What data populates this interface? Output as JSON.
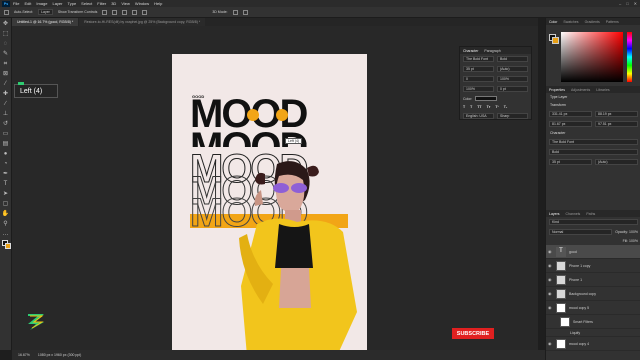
{
  "menubar": {
    "logo": "Ps",
    "items": [
      "File",
      "Edit",
      "Image",
      "Layer",
      "Type",
      "Select",
      "Filter",
      "3D",
      "View",
      "Window",
      "Help"
    ]
  },
  "options": {
    "auto_select": "Auto-Select:",
    "layer_mode": "Layer",
    "show_transform": "Show Transform Controls",
    "mode_3d": "3D Mode:"
  },
  "tabs": [
    {
      "label": "Untitled-1 @ 16.7% (good, RGB/8) *"
    },
    {
      "label": "Restore-to-Hi-RES(dlt) by xxaphei.jpg @ 25% (Background copy, RGB/8) *"
    }
  ],
  "tooltip": {
    "text": "Left (4)"
  },
  "poster": {
    "small_word": "GOOD",
    "big_word": "MOOD",
    "cursor_label": "Left (4)"
  },
  "character_panel": {
    "tabs": [
      "Character",
      "Paragraph"
    ],
    "font_family": "The Bold Font",
    "font_style": "Bold",
    "size": "35 pt",
    "leading": "(Auto)",
    "tracking": "0",
    "vscale": "100%",
    "hscale": "100%",
    "baseline": "0 pt",
    "color_label": "Color:",
    "language": "English: USA",
    "aa": "Sharp"
  },
  "color_panel": {
    "tabs": [
      "Color",
      "Swatches",
      "Gradients",
      "Patterns"
    ],
    "foreground": "#111111",
    "background": "#e8a016"
  },
  "properties": {
    "tabs": [
      "Properties",
      "Adjustments",
      "Libraries"
    ],
    "type_layer": "Type Layer",
    "transform": "Transform",
    "w": "331.41 px",
    "h": "88.19 px",
    "x": "81.67 px",
    "y": "97.51 px",
    "character": "Character",
    "font": "The Bold Font",
    "style": "Bold",
    "size": "35 pt",
    "leading": "(Auto)"
  },
  "layers": {
    "tabs": [
      "Layers",
      "Channels",
      "Paths"
    ],
    "kind": "Kind",
    "blend": "Normal",
    "opacity": "Opacity: 100%",
    "fill": "Fill: 100%",
    "items": [
      {
        "name": "good"
      },
      {
        "name": "Phone 1 copy"
      },
      {
        "name": "Phone 1"
      },
      {
        "name": "Background copy"
      },
      {
        "name": "mood copy 5"
      },
      {
        "name": "Smart Filters"
      },
      {
        "name": "Liquify"
      },
      {
        "name": "mood copy 4"
      }
    ]
  },
  "status": {
    "zoom": "16.67%",
    "doc": "1080 px x 1960 px (300 ppi)"
  },
  "overlay": {
    "subscribe": "SUBSCRIBE"
  }
}
